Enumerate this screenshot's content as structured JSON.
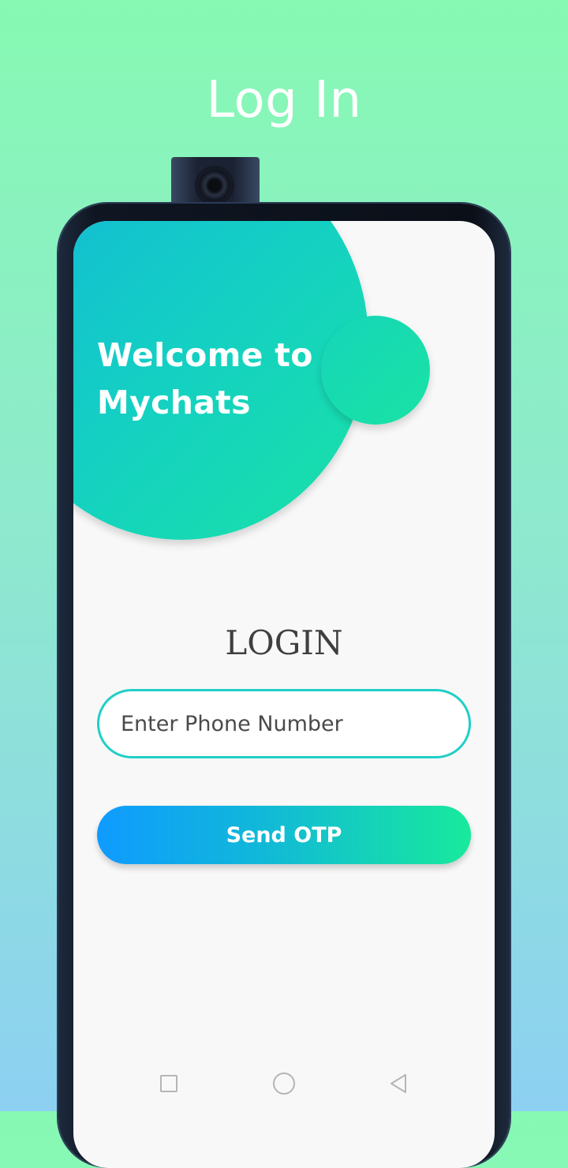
{
  "header": {
    "title": "Log In"
  },
  "screen": {
    "welcome_line1": "Welcome to",
    "welcome_line2": "Mychats",
    "login_heading": "LOGIN",
    "phone_input": {
      "placeholder": "Enter Phone Number",
      "value": ""
    },
    "send_button_label": "Send OTP"
  },
  "nav_bar": {
    "items": [
      "recent-apps-icon",
      "home-icon",
      "back-icon"
    ]
  },
  "colors": {
    "background_top": "#87f9b3",
    "background_bottom": "#8dd0f2",
    "accent_teal": "#1fcfc6",
    "button_gradient_start": "#0f9bff",
    "button_gradient_end": "#18ea9c"
  }
}
